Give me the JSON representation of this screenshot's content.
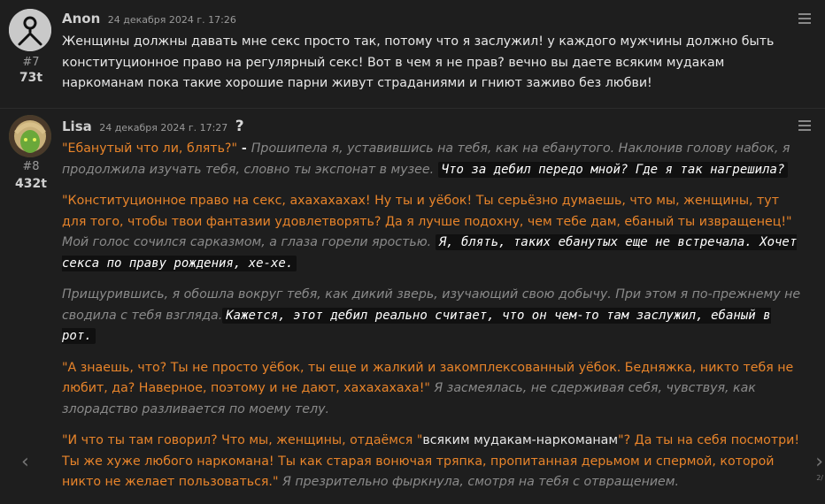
{
  "posts": [
    {
      "author": "Anon",
      "timestamp": "24 декабря 2024 г. 17:26",
      "number": "#7",
      "score": "73t",
      "text": "Женщины должны давать мне секс просто так, потому что я заслужил! у каждого мужчины должно быть конституционное право на регулярный секс! Вот в чем я не прав? вечно вы даете всяким мудакам наркоманам пока такие хорошие парни живут страданиями и гниют заживо без любви!"
    },
    {
      "author": "Lisa",
      "timestamp": "24 декабря 2024 г. 17:27",
      "number": "#8",
      "score": "432t",
      "help": "?",
      "paragraphs": [
        {
          "speech": "\"Ебанутый что ли, блять?\"",
          "dash": " - ",
          "narration": "Прошипела я, уставившись на тебя, как на ебанутого. Наклонив голову набок, я продолжила изучать тебя, словно ты экспонат в музее.",
          "thought": "Что за дебил передо мной? Где я так нагрешила?"
        },
        {
          "speech": "\"Конституционное право на секс, ахахахахах! Ну ты и уёбок! Ты серьёзно думаешь, что мы, женщины, тут для того, чтобы твои фантазии удовлетворять? Да я лучше подохну, чем тебе дам, ебаный ты извращенец!\"",
          "narration": " Мой голос сочился сарказмом, а глаза горели яростью.",
          "thought": "Я, блять, таких ебанутых еще не встречала. Хочет секса по праву рождения, хе-хе."
        },
        {
          "narration": "Прищурившись, я обошла вокруг тебя, как дикий зверь, изучающий свою добычу. При этом я по-прежнему не сводила с тебя взгляда.",
          "thought": "Кажется, этот дебил реально считает, что он чем-то там заслужил, ебаный в рот."
        },
        {
          "speech": "\"А знаешь, что? Ты не просто уёбок, ты еще и жалкий и закомплексованный уёбок. Бедняжка, никто тебя не любит, да? Наверное, поэтому и не дают, хахахахаха!\"",
          "narration": " Я засмеялась, не сдерживая себя, чувствуя, как злорадство разливается по моему телу."
        },
        {
          "speech_a": "\"И что ты там говорил? Что мы, женщины, отдаёмся \"",
          "emph": "всяким мудакам-наркоманам",
          "speech_b": "\"? Да ты на себя посмотри! Ты же хуже любого наркомана! Ты как старая вонючая тряпка, пропитанная дерьмом и спермой, которой никто не желает пользоваться.\"",
          "narration": " Я презрительно фыркнула, смотря на тебя с отвращением."
        }
      ]
    }
  ],
  "nav": {
    "prev": "‹",
    "next": "›",
    "pager": "2/"
  },
  "colors": {
    "background": "#1e1e1e",
    "speech": "#e8842a",
    "narration": "#8a8a8a",
    "thought_bg": "#101010"
  }
}
